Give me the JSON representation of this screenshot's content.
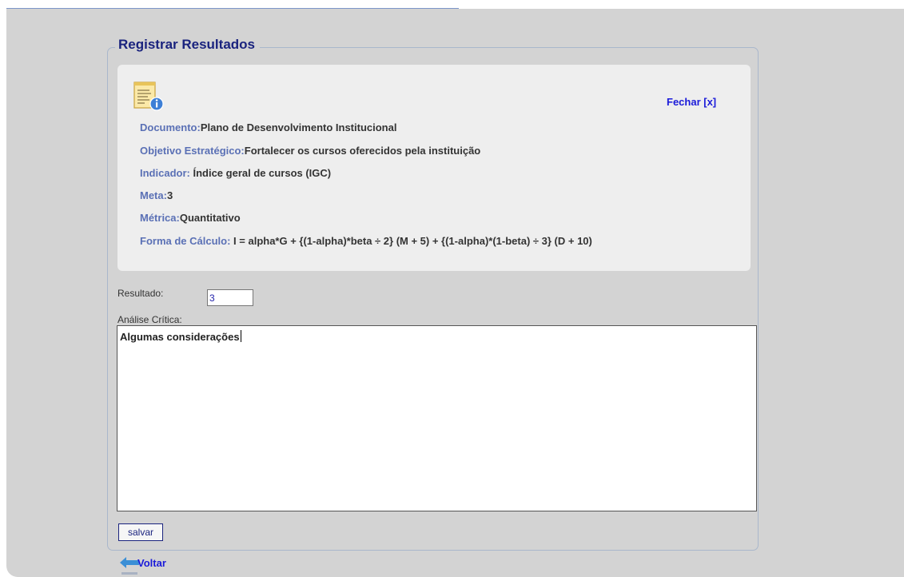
{
  "section": {
    "title": "Registrar Resultados"
  },
  "info": {
    "close_label": "Fechar [x]",
    "documento": {
      "label": "Documento:",
      "value": "Plano de Desenvolvimento Institucional"
    },
    "objetivo": {
      "label": "Objetivo Estratégico:",
      "value": "Fortalecer os cursos oferecidos pela instituição"
    },
    "indicador": {
      "label": "Indicador:",
      "value": "Índice geral de cursos (IGC)"
    },
    "meta": {
      "label": "Meta:",
      "value": "3"
    },
    "metrica": {
      "label": "Métrica:",
      "value": "Quantitativo"
    },
    "forma_calculo": {
      "label": "Forma de Cálculo:",
      "value": "I = alpha*G + {(1-alpha)*beta ÷ 2} (M + 5) + {(1-alpha)*(1-beta) ÷ 3} (D + 10)"
    }
  },
  "form": {
    "resultado_label": "Resultado:",
    "resultado_value": "3",
    "analise_label": "Análise Crítica:",
    "analise_value": "Algumas considerações",
    "save_label": "salvar"
  },
  "nav": {
    "back_label": "Voltar"
  },
  "colors": {
    "page_bg": "#d3d3d3",
    "heading": "#1a237e",
    "label_blue": "#5a70b5",
    "link_blue": "#1a1ad9"
  },
  "icons": {
    "document": "document-info-icon",
    "back": "back-arrow-icon"
  }
}
